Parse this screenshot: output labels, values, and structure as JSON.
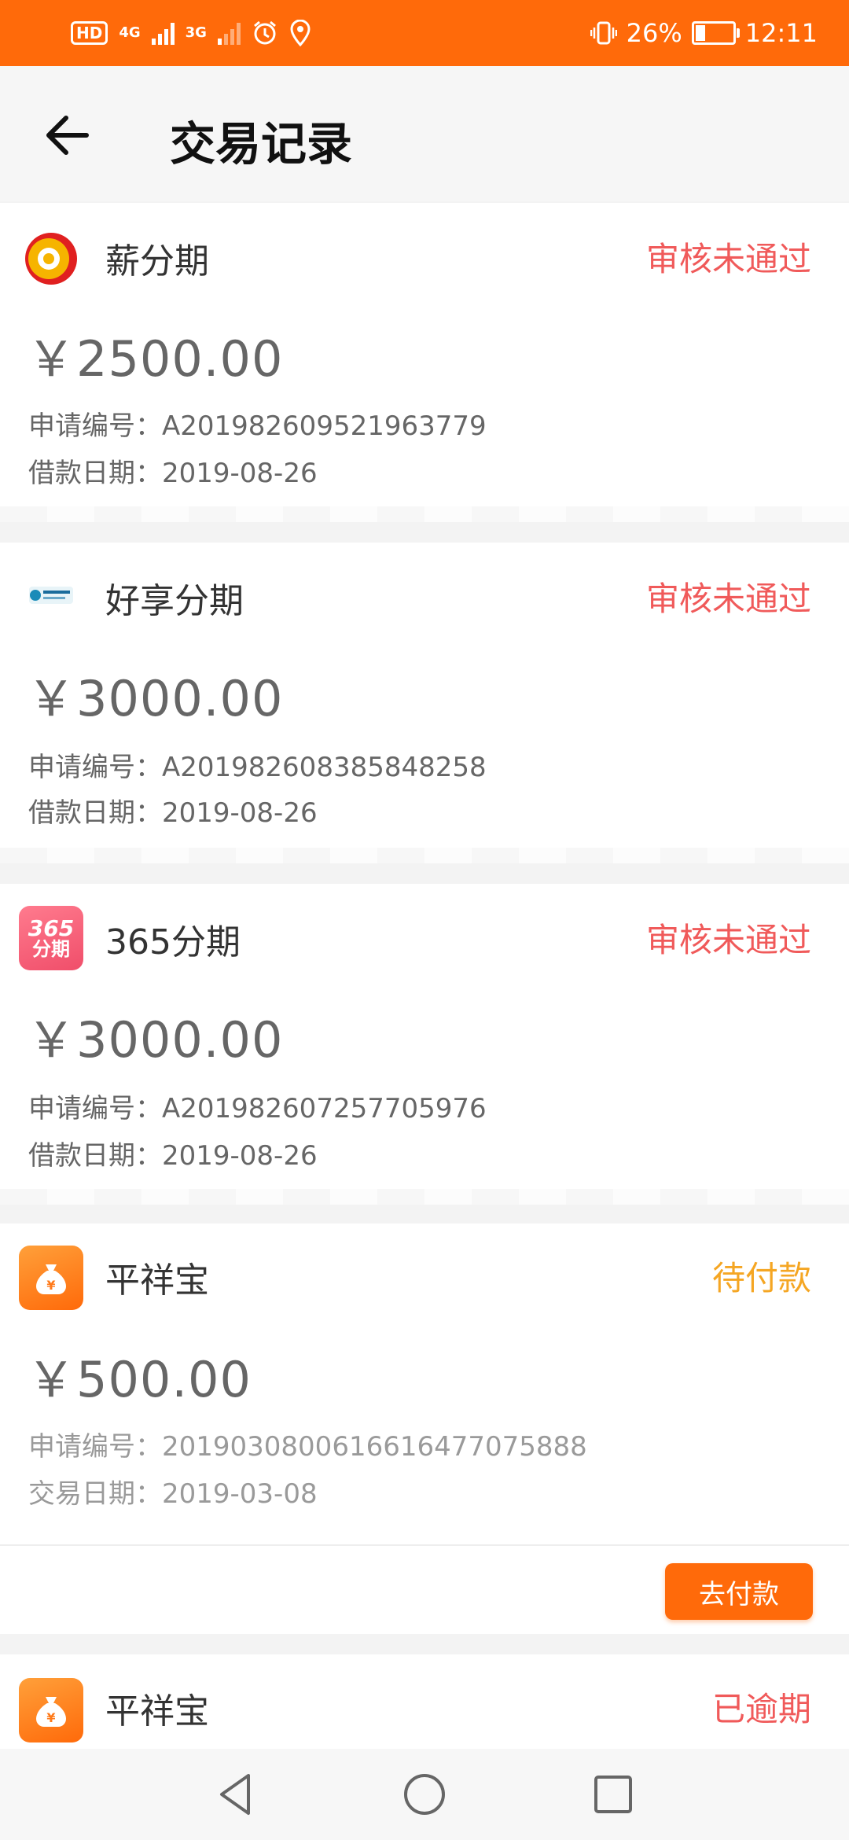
{
  "status_bar": {
    "hd": "HD",
    "net1": "4G",
    "net2": "3G",
    "battery": "26%",
    "time": "12:11"
  },
  "header": {
    "title": "交易记录"
  },
  "colors": {
    "accent": "#ff6a0a",
    "rejected": "#f05a5a",
    "pending": "#f5a623",
    "overdue": "#f05a5a"
  },
  "records": [
    {
      "provider": "薪分期",
      "logo_icon": "xin-fenqi-logo-icon",
      "status": "审核未通过",
      "amount": "￥2500.00",
      "line1": "申请编号：A201982609521963779",
      "line2": "借款日期：2019-08-26"
    },
    {
      "provider": "好享分期",
      "logo_icon": "haoxiang-fenqi-logo-icon",
      "status": "审核未通过",
      "amount": "￥3000.00",
      "line1": "申请编号：A201982608385848258",
      "line2": "借款日期：2019-08-26"
    },
    {
      "provider": "365分期",
      "logo_icon": "365-fenqi-logo-icon",
      "logo_text": [
        "365",
        "分期"
      ],
      "status": "审核未通过",
      "amount": "￥3000.00",
      "line1": "申请编号：A201982607257705976",
      "line2": "借款日期：2019-08-26"
    },
    {
      "provider": "平祥宝",
      "logo_icon": "money-bag-logo-icon",
      "status": "待付款",
      "amount": "￥500.00",
      "line1": "申请编号：2019030800616616477075888",
      "line2": "交易日期：2019-03-08",
      "action": "去付款"
    },
    {
      "provider": "平祥宝",
      "logo_icon": "money-bag-logo-icon",
      "status": "已逾期"
    }
  ]
}
